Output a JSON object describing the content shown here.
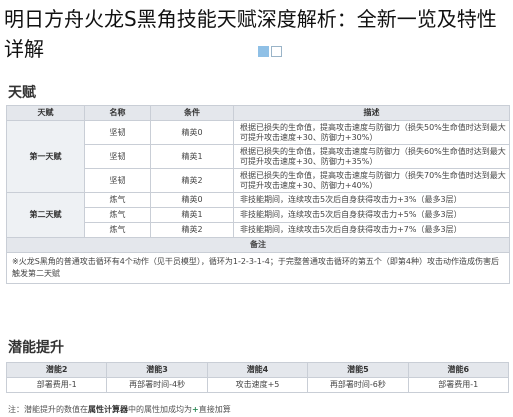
{
  "title": "明日方舟火龙S黑角技能天赋深度解析：全新一览及特性详解",
  "talent_section": {
    "heading": "天赋",
    "headers": [
      "天赋",
      "名称",
      "条件",
      "描述"
    ],
    "group1_label": "第一天赋",
    "group2_label": "第二天赋",
    "rows": [
      {
        "name": "坚韧",
        "condition": "精英0",
        "desc": "根据已损失的生命值，提高攻击速度与防御力（损失50%生命值时达到最大可提升攻击速度+30、防御力+30%）"
      },
      {
        "name": "坚韧",
        "condition": "精英1",
        "desc": "根据已损失的生命值，提高攻击速度与防御力（损失60%生命值时达到最大可提升攻击速度+30、防御力+35%）"
      },
      {
        "name": "坚韧",
        "condition": "精英2",
        "desc": "根据已损失的生命值，提高攻击速度与防御力（损失70%生命值时达到最大可提升攻击速度+30、防御力+40%）"
      },
      {
        "name": "炼气",
        "condition": "精英0",
        "desc": "非技能期间，连续攻击5次后自身获得攻击力+3%（最多3层）"
      },
      {
        "name": "炼气",
        "condition": "精英1",
        "desc": "非技能期间，连续攻击5次后自身获得攻击力+5%（最多3层）"
      },
      {
        "name": "炼气",
        "condition": "精英2",
        "desc": "非技能期间，连续攻击5次后自身获得攻击力+7%（最多3层）"
      }
    ],
    "note_header": "备注",
    "note_text": "※火龙S黑角的普通攻击循环有4个动作（见干员模型），循环为1-2-3-1-4；于完整普通攻击循环的第五个（即第4种）攻击动作造成伤害后触发第二天赋"
  },
  "potential_section": {
    "heading": "潜能提升",
    "headers": [
      "潜能2",
      "潜能3",
      "潜能4",
      "潜能5",
      "潜能6"
    ],
    "values": [
      "部署费用-1",
      "再部署时间-4秒",
      "攻击速度+5",
      "再部署时间-6秒",
      "部署费用-1"
    ]
  },
  "footnote": {
    "prefix": "注：潜能提升的数值在",
    "highlight": "属性计算器",
    "middle": "中的属性加成均为",
    "plus": "+",
    "suffix": "直接加算"
  }
}
